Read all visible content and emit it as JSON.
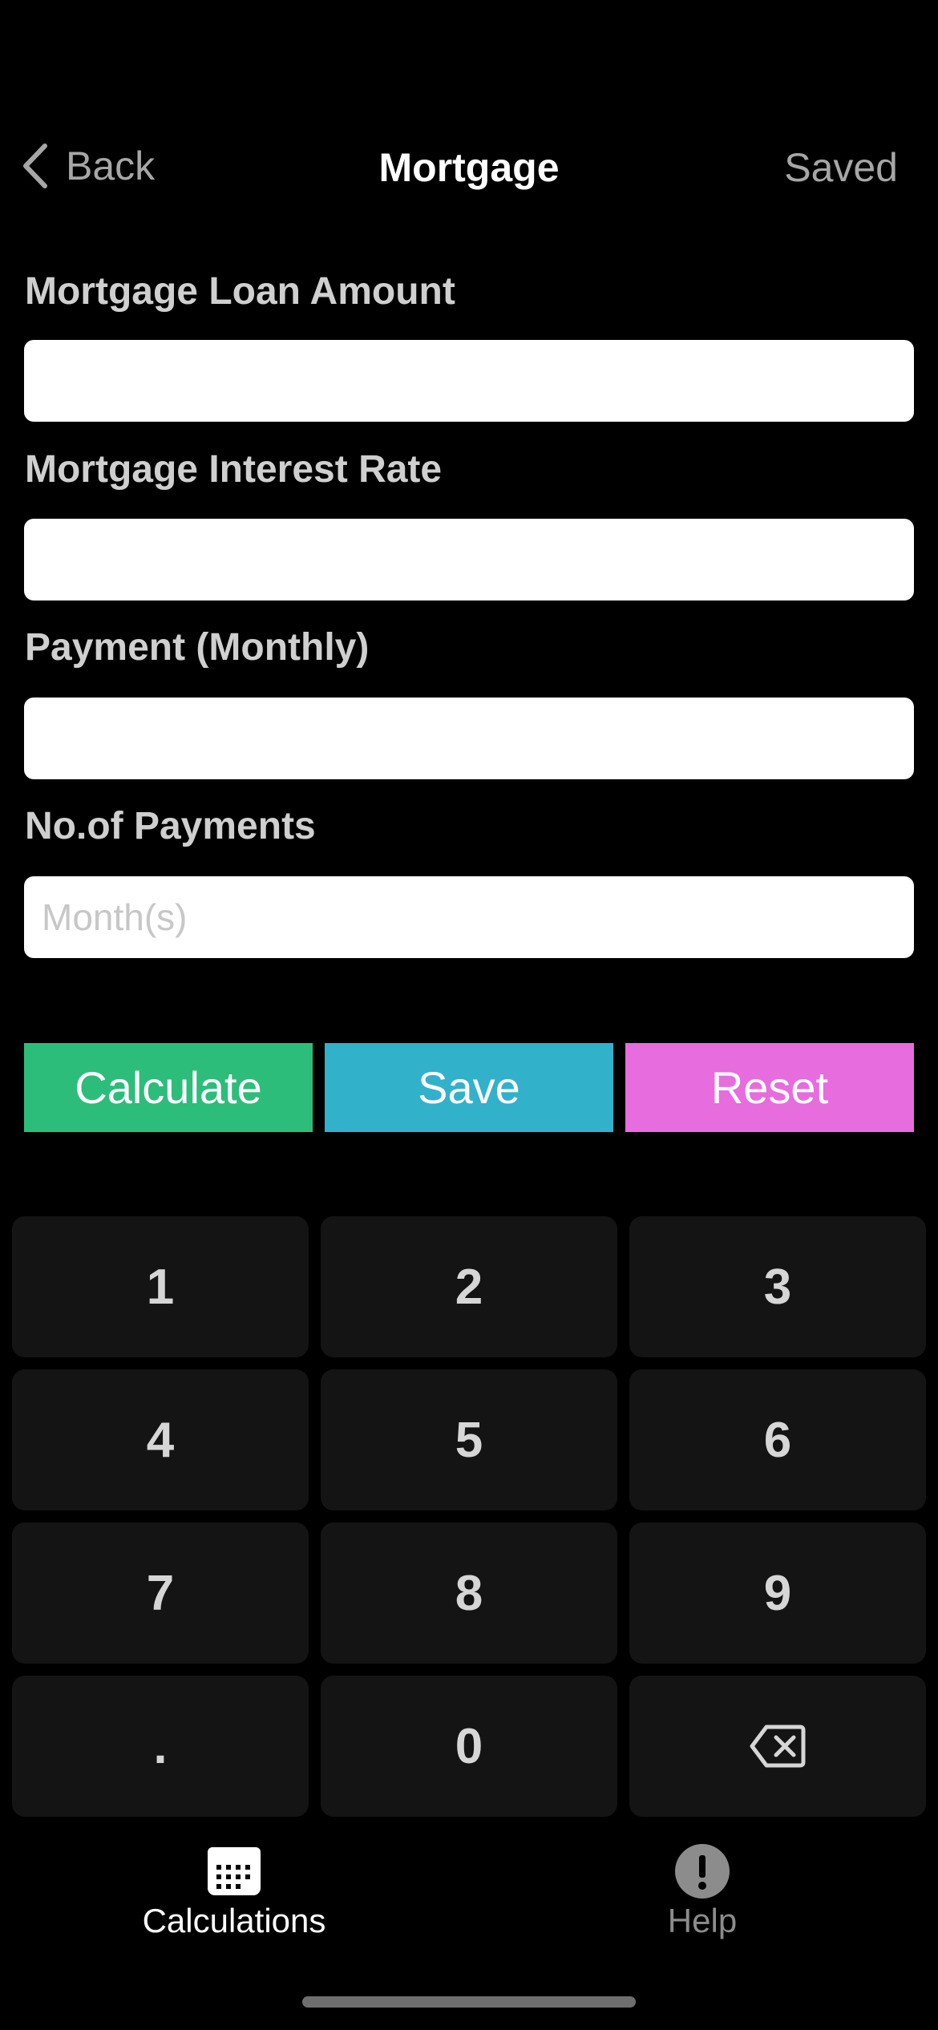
{
  "nav": {
    "back_label": "Back",
    "title": "Mortgage",
    "saved_label": "Saved"
  },
  "fields": {
    "loan_amount": {
      "label": "Mortgage Loan Amount",
      "value": "",
      "placeholder": ""
    },
    "interest_rate": {
      "label": "Mortgage Interest Rate",
      "value": "",
      "placeholder": ""
    },
    "payment": {
      "label": "Payment (Monthly)",
      "value": "",
      "placeholder": ""
    },
    "num_payments": {
      "label": "No.of Payments",
      "value": "",
      "placeholder": "Month(s)"
    }
  },
  "actions": {
    "calculate_label": "Calculate",
    "save_label": "Save",
    "reset_label": "Reset",
    "calculate_color": "#2dbd7a",
    "save_color": "#32b1cb",
    "reset_color": "#e76cde"
  },
  "keypad": {
    "keys": [
      "1",
      "2",
      "3",
      "4",
      "5",
      "6",
      "7",
      "8",
      "9",
      ".",
      "0"
    ],
    "backspace_icon": "backspace-icon"
  },
  "tabbar": {
    "calculations_label": "Calculations",
    "calculations_icon": "keypad-icon",
    "help_label": "Help",
    "help_icon": "exclamation-icon"
  }
}
